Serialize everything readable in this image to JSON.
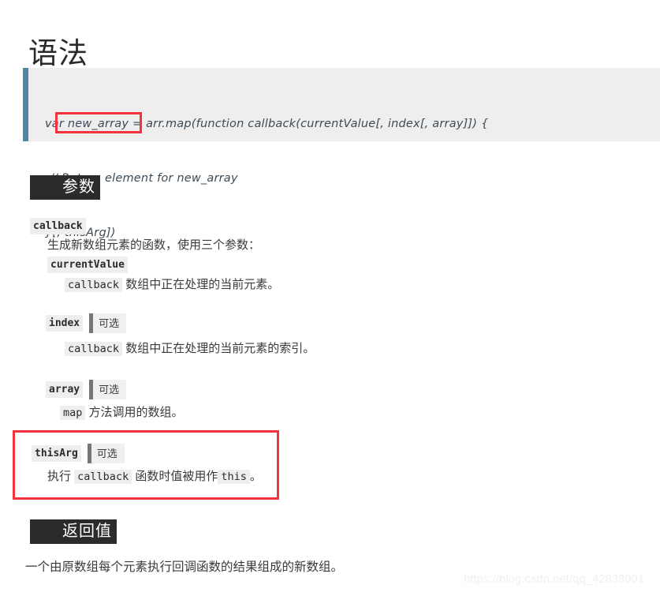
{
  "page": {
    "title": "语法"
  },
  "code_block": {
    "accent_color": "#4d87a3",
    "background": "#eeeeee",
    "lines": [
      "var new_array = arr.map(function callback(currentValue[, index[, array]]) {",
      "// Return element for new_array",
      "}[, thisArg])"
    ],
    "highlight_color": "#f5333f",
    "highlight_text": "[, thisArg])"
  },
  "sections": {
    "params_heading": "参数",
    "returns_heading": "返回值",
    "returns_text": "一个由原数组每个元素执行回调函数的结果组成的新数组。"
  },
  "optional_badge_label": "可选",
  "params": [
    {
      "name": "callback",
      "optional": false,
      "desc_prefix": "",
      "desc_code": "",
      "desc_text": "生成新数组元素的函数，使用三个参数："
    },
    {
      "name": "currentValue",
      "optional": false,
      "desc_prefix": "",
      "desc_code": "callback",
      "desc_text": " 数组中正在处理的当前元素。"
    },
    {
      "name": "index",
      "optional": true,
      "desc_prefix": "",
      "desc_code": "callback",
      "desc_text": " 数组中正在处理的当前元素的索引。"
    },
    {
      "name": "array",
      "optional": true,
      "desc_prefix": "",
      "desc_code": "map",
      "desc_text": " 方法调用的数组。"
    },
    {
      "name": "thisArg",
      "optional": true,
      "desc_prefix": "执行 ",
      "desc_code": "callback",
      "desc_text": " 函数时值被用作",
      "desc_code2": "this",
      "desc_suffix": "。"
    }
  ],
  "watermark": "https://blog.csdn.net/qq_42833001"
}
